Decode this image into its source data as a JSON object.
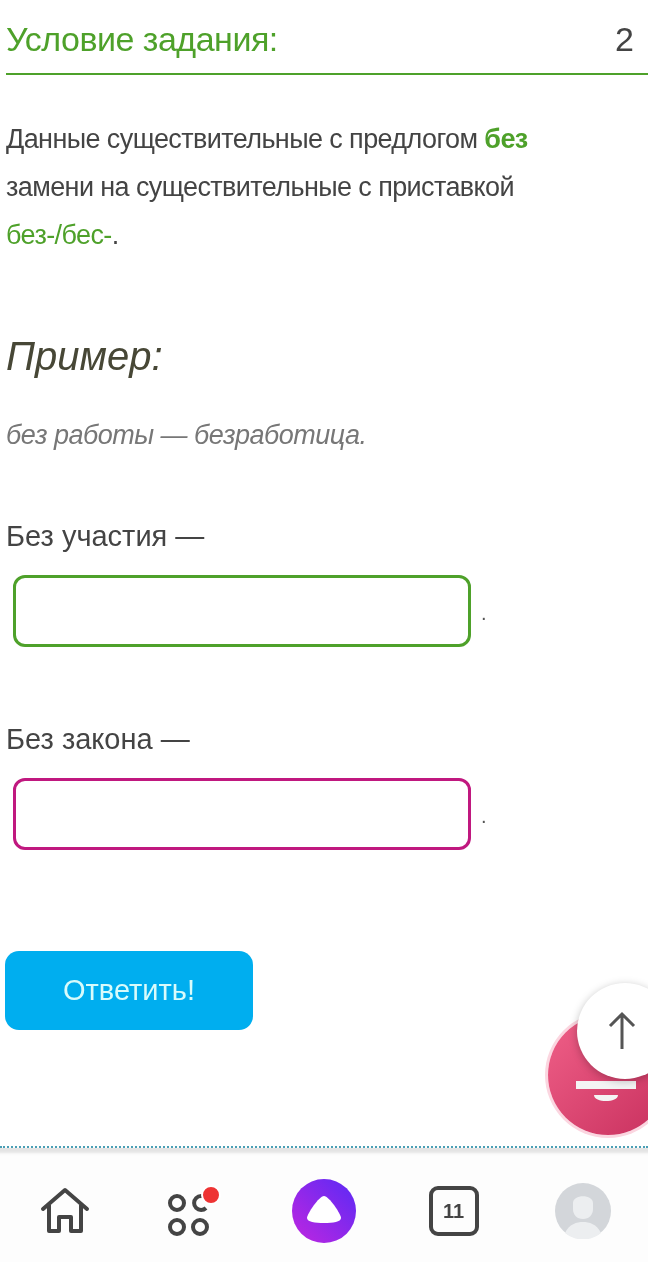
{
  "task": {
    "title": "Условие задания:",
    "points": "2",
    "instruction": [
      {
        "kind": "plain",
        "text": "Данные существительные с предлогом "
      },
      {
        "kind": "strong-accent",
        "text": "без"
      },
      {
        "kind": "plain",
        "text": " замени на существительные с приставкой "
      },
      {
        "kind": "accent",
        "text": "без-/бес-"
      },
      {
        "kind": "plain",
        "text": "."
      }
    ],
    "example_title": "Пример:",
    "example": "без работы — безработица.",
    "items": [
      {
        "prompt": "Без участия —",
        "color": "#4ea12a",
        "end": "."
      },
      {
        "prompt": "Без закона —",
        "color": "#c0187f",
        "end": "."
      }
    ],
    "submit": "Ответить!"
  },
  "bottom_nav": {
    "tab_count": "11",
    "apps_badge": true
  }
}
